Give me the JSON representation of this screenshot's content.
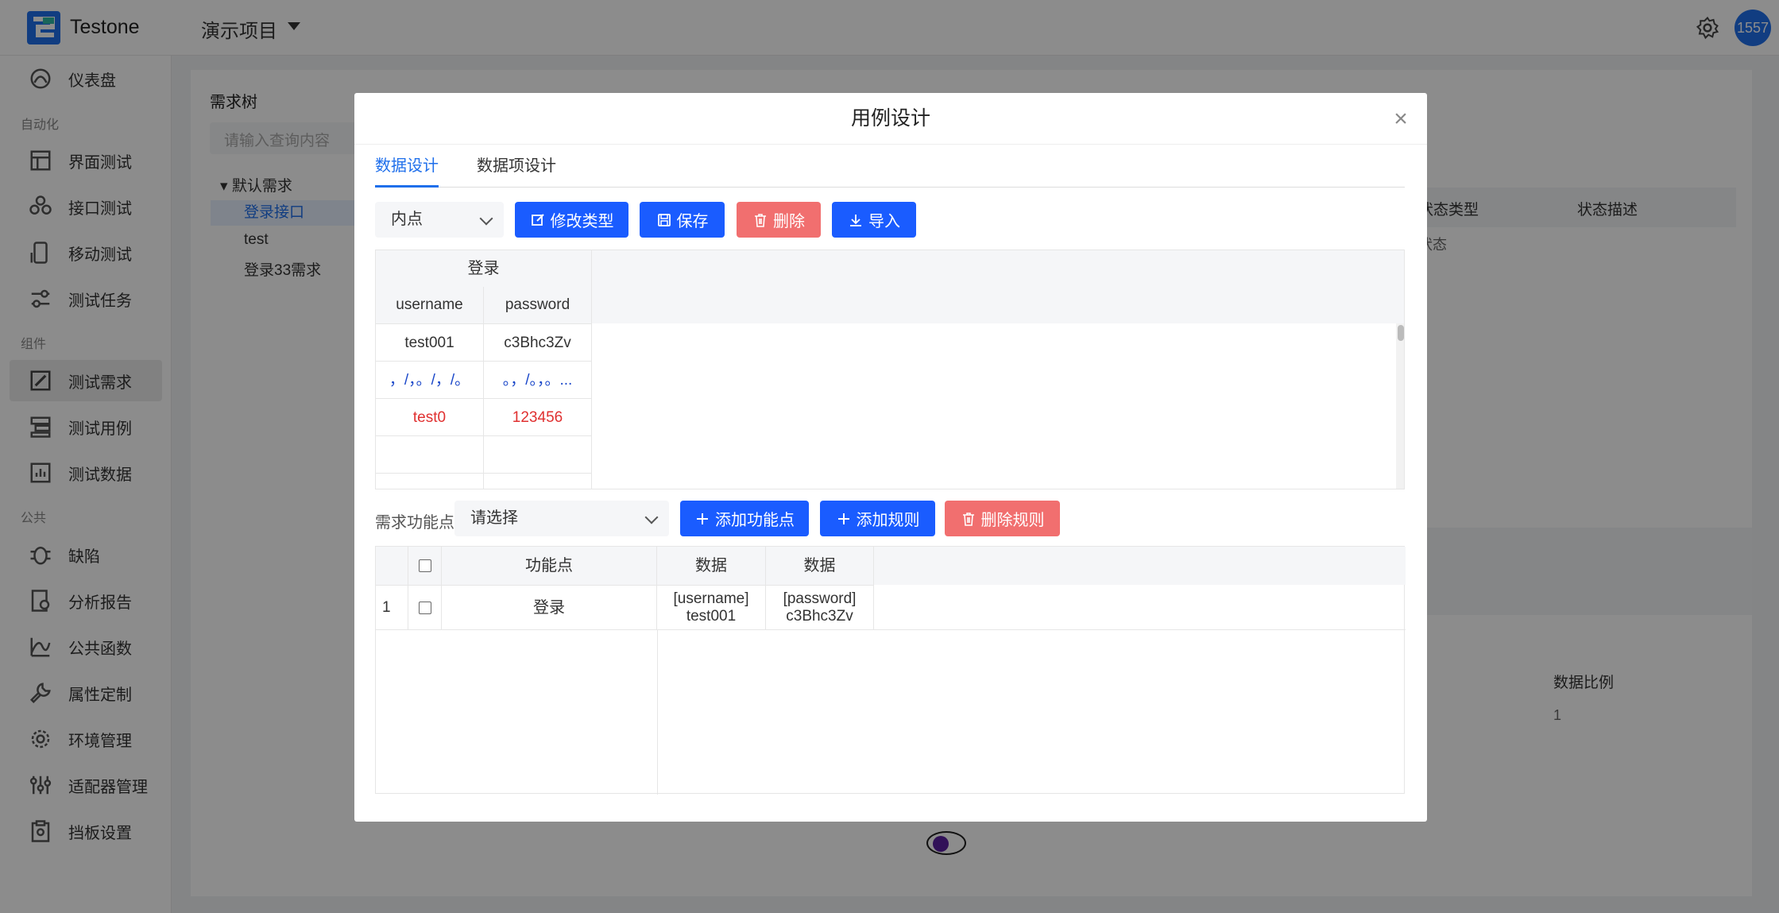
{
  "header": {
    "app_name": "Testone",
    "project_name": "演示项目",
    "avatar_text": "1557"
  },
  "sidebar": {
    "items": [
      {
        "label": "仪表盘",
        "icon": "dashboard-icon"
      },
      {
        "label": "界面测试",
        "icon": "layout-icon"
      },
      {
        "label": "接口测试",
        "icon": "api-icon"
      },
      {
        "label": "移动测试",
        "icon": "mobile-icon"
      },
      {
        "label": "测试任务",
        "icon": "task-icon"
      },
      {
        "label": "测试需求",
        "icon": "requirement-icon"
      },
      {
        "label": "测试用例",
        "icon": "testcase-icon"
      },
      {
        "label": "测试数据",
        "icon": "testdata-icon"
      },
      {
        "label": "缺陷",
        "icon": "bug-icon"
      },
      {
        "label": "分析报告",
        "icon": "report-icon"
      },
      {
        "label": "公共函数",
        "icon": "function-icon"
      },
      {
        "label": "属性定制",
        "icon": "wrench-icon"
      },
      {
        "label": "环境管理",
        "icon": "gear-icon"
      },
      {
        "label": "适配器管理",
        "icon": "adapter-icon"
      },
      {
        "label": "挡板设置",
        "icon": "mock-icon"
      }
    ],
    "groups": [
      "自动化",
      "组件",
      "公共"
    ],
    "active_item": "测试需求"
  },
  "background": {
    "tree_title": "需求树",
    "search_placeholder": "请输入查询内容",
    "tree_nodes": [
      "默认需求",
      "登录接口",
      "test",
      "登录33需求"
    ],
    "table1_headers": [
      "状态类型",
      "状态描述"
    ],
    "table1_cell": "状态",
    "table2_header": "数据比例",
    "table2_cell": "1"
  },
  "modal": {
    "title": "用例设计",
    "tabs": [
      "数据设计",
      "数据项设计"
    ],
    "active_tab": "数据设计",
    "type_select": "内点",
    "buttons": {
      "edit_type": "修改类型",
      "save": "保存",
      "delete": "删除",
      "import": "导入"
    },
    "data_table": {
      "group_header": "登录",
      "columns": [
        "username",
        "password"
      ],
      "rows": [
        [
          "test001",
          "c3Bhc3Zv"
        ],
        [
          "，/，。/，/。",
          "。，/。，。..."
        ],
        [
          "test0",
          "123456"
        ],
        [
          "",
          ""
        ]
      ]
    },
    "function_label": "需求功能点",
    "function_select_placeholder": "请选择",
    "function_buttons": {
      "add_function": "添加功能点",
      "add_rule": "添加规则",
      "delete_rule": "删除规则"
    },
    "function_table": {
      "headers": [
        "",
        "",
        "功能点",
        "数据",
        "数据"
      ],
      "rows": [
        {
          "index": "1",
          "function": "登录",
          "data1": "[username] test001",
          "data2": "[password] c3Bhc3Zv"
        }
      ]
    }
  }
}
